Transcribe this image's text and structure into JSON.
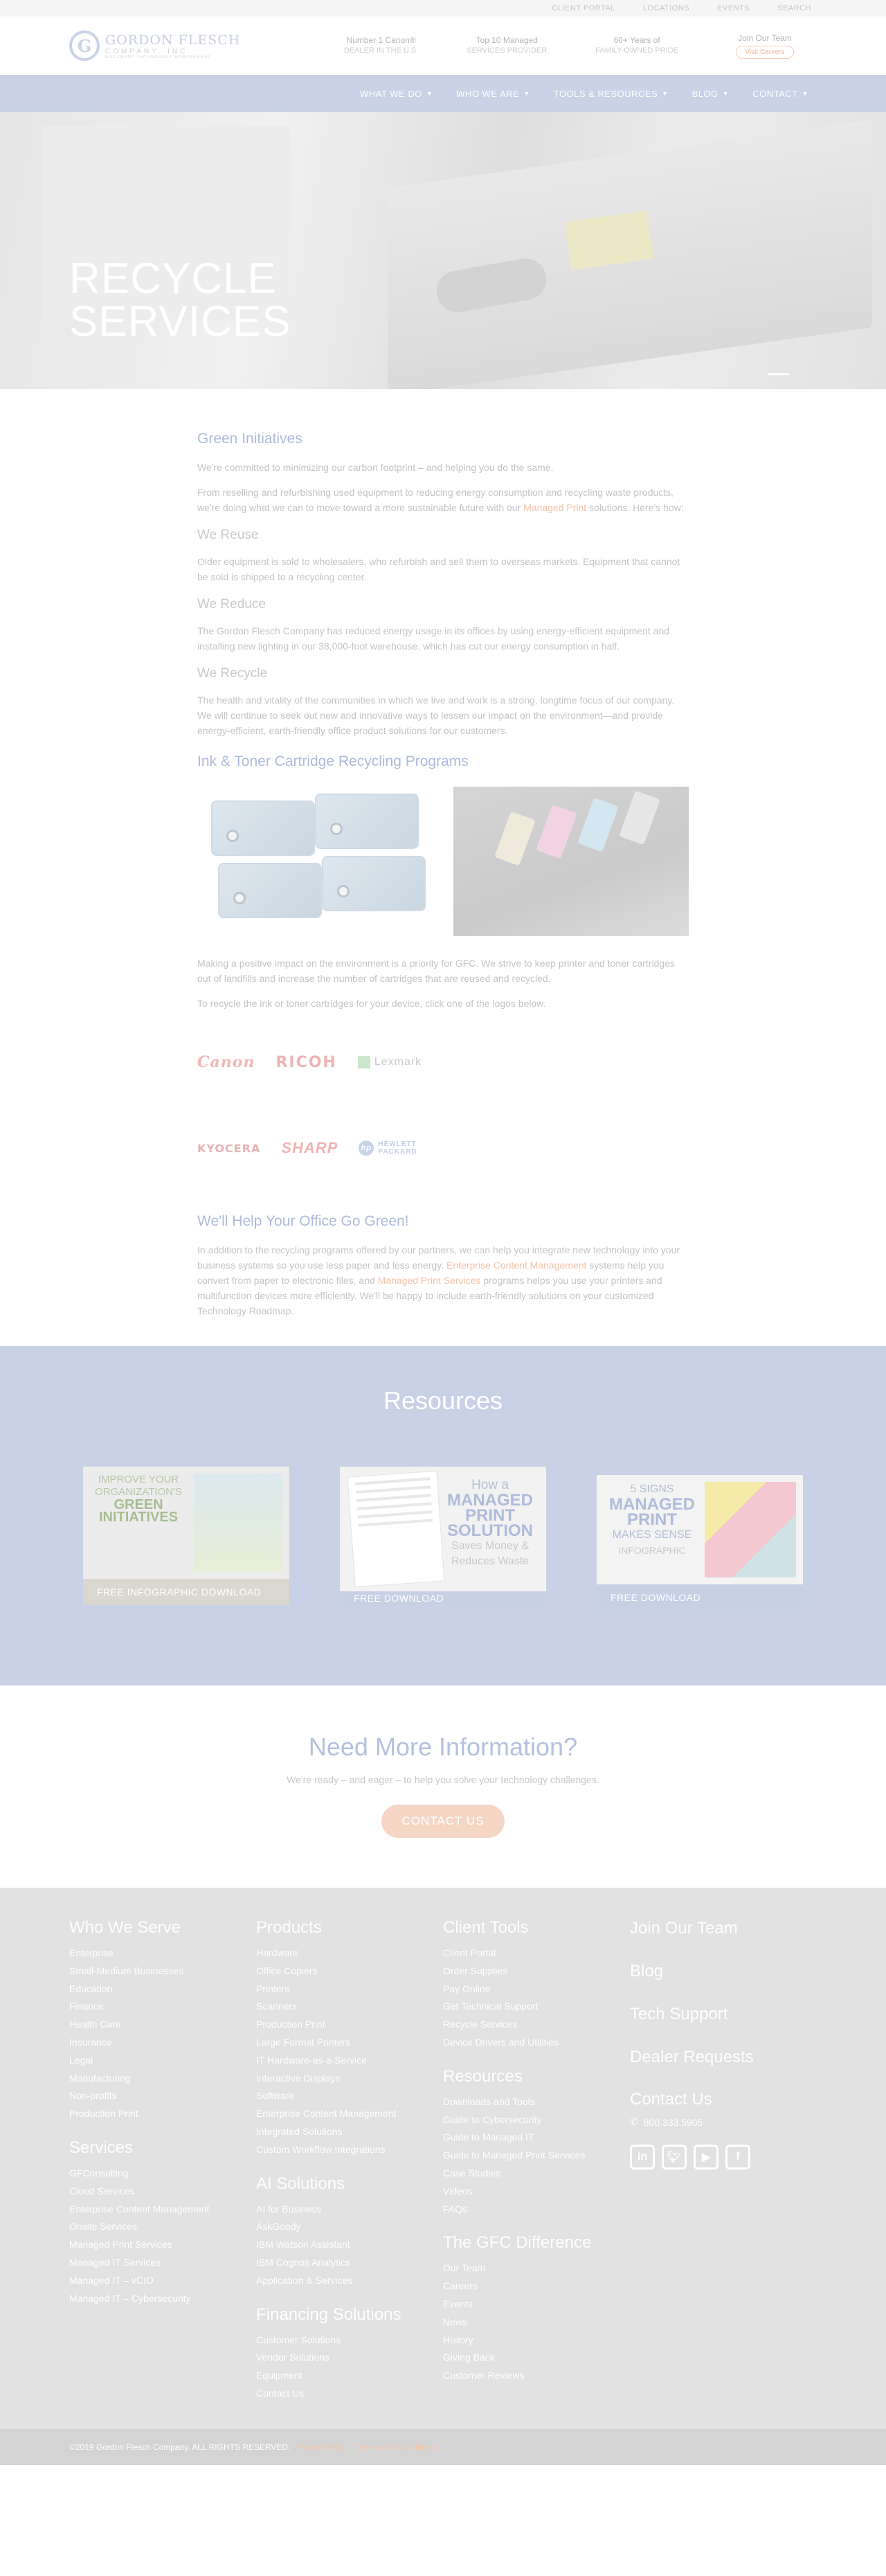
{
  "utility": {
    "links": [
      "CLIENT PORTAL",
      "LOCATIONS",
      "EVENTS",
      "SEARCH"
    ]
  },
  "header": {
    "logo_initial": "G",
    "logo_name": "GORDON FLESCH",
    "logo_sub": "COMPANY, INC.",
    "logo_tag": "DOCUMENT TECHNOLOGY MANAGEMENT",
    "stats": [
      {
        "title": "Number 1 Canon®",
        "sub": "DEALER IN THE U.S."
      },
      {
        "title": "Top 10 Managed",
        "sub": "SERVICES PROVIDER"
      },
      {
        "title": "60+ Years of",
        "sub": "FAMILY-OWNED PRIDE"
      }
    ],
    "join_label": "Join Our Team",
    "join_button": "Visit Careers"
  },
  "nav": {
    "items": [
      "WHAT WE DO",
      "WHO WE ARE",
      "TOOLS & RESOURCES",
      "BLOG",
      "CONTACT"
    ]
  },
  "hero": {
    "title_line1": "RECYCLE",
    "title_line2": "SERVICES"
  },
  "green": {
    "heading": "Green Initiatives",
    "p1": "We're committed to minimizing our carbon footprint – and helping you do the same.",
    "p2_before": "From reselling and refurbishing used equipment to reducing energy consumption and recycling waste products, we're doing what we can to move toward a more sustainable future with our ",
    "p2_link": "Managed Print",
    "p2_after": " solutions. Here's how:",
    "reuse_heading": "We Reuse",
    "reuse_text": "Older equipment is sold to wholesalers, who refurbish and sell them to overseas markets. Equipment that cannot be sold is shipped to a recycling center.",
    "reduce_heading": "We Reduce",
    "reduce_text": "The Gordon Flesch Company has reduced energy usage in its offices by using energy-efficient equipment and installing new lighting in our 38,000-foot warehouse, which has cut our energy consumption in half.",
    "recycle_heading": "We Recycle",
    "recycle_text": "The health and vitality of the communities in which we live and work is a strong, longtime focus of our company. We will continue to seek out new and innovative ways to lessen our impact on the environment—and provide energy-efficient, earth-friendly office product solutions for our customers."
  },
  "ink": {
    "heading": "Ink & Toner Cartridge Recycling Programs",
    "p1": "Making a positive impact on the environment is a priority for GFC. We strive to keep printer and toner cartridges out of landfills and increase the number of cartridges that are reused and recycled.",
    "p2": "To recycle the ink or toner cartridges for your device, click one of the logos below.",
    "logos_row1": [
      "Canon",
      "RICOH",
      "Lexmark"
    ],
    "logos_row2": [
      "KYOCERA",
      "SHARP",
      "HEWLETT PACKARD"
    ],
    "hp_initials": "hp",
    "hp_line1": "HEWLETT",
    "hp_line2": "PACKARD"
  },
  "help": {
    "heading": "We'll Help Your Office Go Green!",
    "text_before": "In addition to the recycling programs offered by our partners, we can help you integrate new technology into your business systems so you use less paper and less energy. ",
    "link1": "Enterprise Content Management",
    "text_mid": " systems help you convert from paper to electronic files, and ",
    "link2": "Managed Print Services",
    "text_after": " programs helps you use your printers and multifunction devices more efficiently. We'll be happy to include earth-friendly solutions on your customized Technology Roadmap."
  },
  "resources": {
    "heading": "Resources",
    "card1": {
      "line1": "Improve Your",
      "line2": "Organization's",
      "strong": "Green Initiatives",
      "button": "FREE INFOGRAPHIC DOWNLOAD"
    },
    "card2": {
      "line1": "How a",
      "strong1": "Managed",
      "strong2": "Print",
      "strong3": "Solution",
      "line2": "Saves Money &",
      "line3": "Reduces Waste",
      "button": "FREE DOWNLOAD"
    },
    "card3": {
      "line1": "5 Signs",
      "strong1": "Managed",
      "strong2": "Print",
      "line2": "Makes Sense",
      "line3": "INFOGRAPHIC",
      "button": "FREE DOWNLOAD"
    }
  },
  "need": {
    "heading": "Need More Information?",
    "text": "We're ready – and eager – to help you solve your technology challenges.",
    "button": "CONTACT US"
  },
  "footer": {
    "who_we_serve": {
      "heading": "Who We Serve",
      "links": [
        "Enterprise",
        "Small-Medium Businesses",
        "Education",
        "Finance",
        "Health Care",
        "Insurance",
        "Legal",
        "Manufacturing",
        "Non-profits",
        "Production Print"
      ]
    },
    "services": {
      "heading": "Services",
      "links": [
        "GFConsulting",
        "Cloud Services",
        "Enterprise Content Management",
        "Onsite Services",
        "Managed Print Services",
        "Managed IT Services",
        "Managed IT – vCIO",
        "Managed IT – Cybersecurity"
      ]
    },
    "products": {
      "heading": "Products",
      "links": [
        "Hardware",
        "Office Copiers",
        "Printers",
        "Scanners",
        "Production Print",
        "Large Format Printers",
        "IT Hardware-as-a-Service",
        "Interactive Displays",
        "Software",
        "Enterprise Content Management",
        "Integrated Solutions",
        "Custom Workflow Integrations"
      ]
    },
    "ai": {
      "heading": "AI Solutions",
      "links": [
        "AI for Business",
        "AskGoody",
        "IBM Watson Assistant",
        "IBM Cognos Analytics",
        "Application & Services"
      ]
    },
    "financing": {
      "heading": "Financing Solutions",
      "links": [
        "Customer Solutions",
        "Vendor Solutions",
        "Equipment",
        "Contact Us"
      ]
    },
    "client_tools": {
      "heading": "Client Tools",
      "links": [
        "Client Portal",
        "Order Supplies",
        "Pay Online",
        "Get Technical Support",
        "Recycle Services",
        "Device Drivers and Utilities"
      ]
    },
    "res": {
      "heading": "Resources",
      "links": [
        "Downloads and Tools",
        "Guide to Cybersecurity",
        "Guide to Managed IT",
        "Guide to Managed Print Services",
        "Case Studies",
        "Videos",
        "FAQs"
      ]
    },
    "gfc": {
      "heading": "The GFC Difference",
      "links": [
        "Our Team",
        "Careers",
        "Events",
        "News",
        "History",
        "Giving Back",
        "Customer Reviews"
      ]
    },
    "col4": {
      "links": [
        "Join Our Team",
        "Blog",
        "Tech Support",
        "Dealer Requests"
      ],
      "contact_heading": "Contact Us",
      "phone": "800.333.5905"
    },
    "copyright": "©2019 Gordon Flesch Company. ALL RIGHTS RESERVED.",
    "privacy": "Privacy Policy",
    "terms": "Terms and Conditions",
    "sep": "|"
  },
  "colors": {
    "nav": "#c9d2e6",
    "accent": "#f3c2a8",
    "heading": "#aebbdb",
    "footer": "#e2e2e2"
  }
}
